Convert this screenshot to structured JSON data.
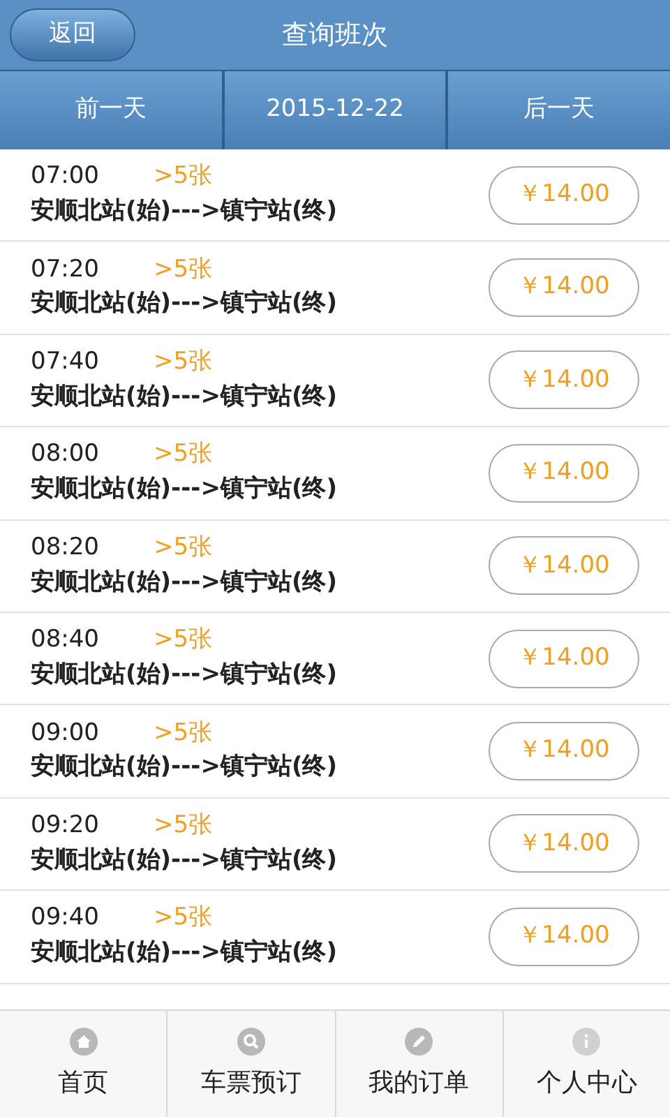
{
  "header": {
    "back_button": "返回",
    "title": "查询班次"
  },
  "date_bar": {
    "previous": "前一天",
    "date": "2015-12-22",
    "next": "后一天"
  },
  "trips": [
    {
      "time": "07:00",
      "tickets": ">5张",
      "route": "安顺北站(始)--->镇宁站(终)",
      "price": "￥14.00"
    },
    {
      "time": "07:20",
      "tickets": ">5张",
      "route": "安顺北站(始)--->镇宁站(终)",
      "price": "￥14.00"
    },
    {
      "time": "07:40",
      "tickets": ">5张",
      "route": "安顺北站(始)--->镇宁站(终)",
      "price": "￥14.00"
    },
    {
      "time": "08:00",
      "tickets": ">5张",
      "route": "安顺北站(始)--->镇宁站(终)",
      "price": "￥14.00"
    },
    {
      "time": "08:20",
      "tickets": ">5张",
      "route": "安顺北站(始)--->镇宁站(终)",
      "price": "￥14.00"
    },
    {
      "time": "08:40",
      "tickets": ">5张",
      "route": "安顺北站(始)--->镇宁站(终)",
      "price": "￥14.00"
    },
    {
      "time": "09:00",
      "tickets": ">5张",
      "route": "安顺北站(始)--->镇宁站(终)",
      "price": "￥14.00"
    },
    {
      "time": "09:20",
      "tickets": ">5张",
      "route": "安顺北站(始)--->镇宁站(终)",
      "price": "￥14.00"
    },
    {
      "time": "09:40",
      "tickets": ">5张",
      "route": "安顺北站(始)--->镇宁站(终)",
      "price": "￥14.00"
    }
  ],
  "bottom_nav": [
    {
      "kind": "home",
      "label": "首页"
    },
    {
      "kind": "search",
      "label": "车票预订"
    },
    {
      "kind": "edit",
      "label": "我的订单"
    },
    {
      "kind": "info",
      "label": "个人中心"
    }
  ]
}
